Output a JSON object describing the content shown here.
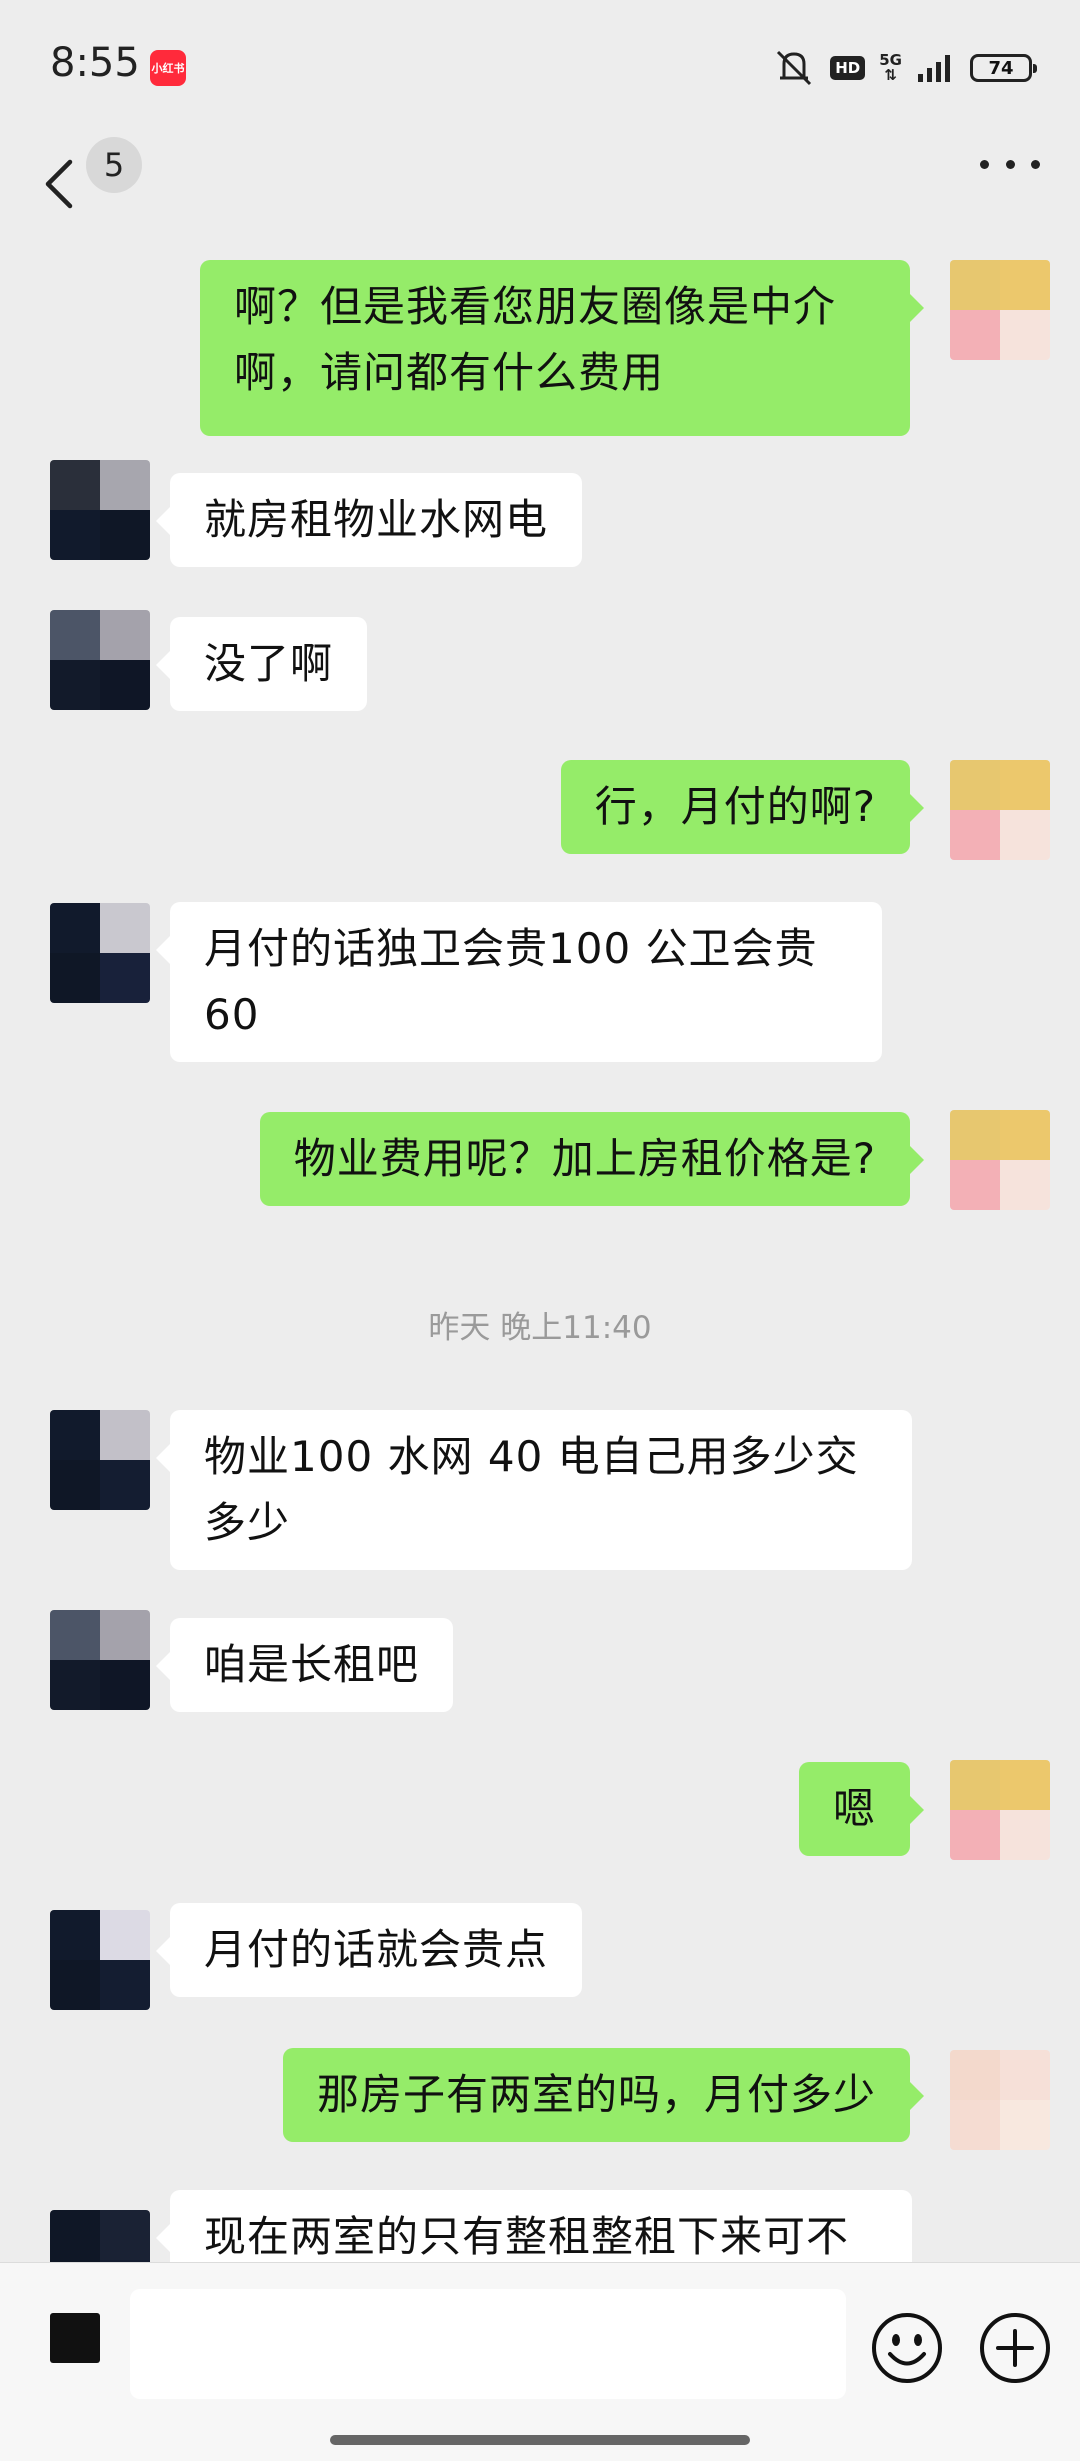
{
  "status_bar": {
    "time": "8:55",
    "app_badge": "小红书",
    "hd": "HD",
    "network": "5G",
    "battery": "74"
  },
  "nav": {
    "unread_count": "5"
  },
  "colors": {
    "outgoing_bubble": "#95ec69",
    "incoming_bubble": "#ffffff",
    "background": "#ededed"
  },
  "messages": [
    {
      "dir": "out",
      "text": "啊？但是我看您朋友圈像是中介啊，请问都有什么费用"
    },
    {
      "dir": "in",
      "text": "就房租物业水网电"
    },
    {
      "dir": "in",
      "text": "没了啊"
    },
    {
      "dir": "out",
      "text": "行，月付的啊?"
    },
    {
      "dir": "in",
      "text": "月付的话独卫会贵100 公卫会贵60"
    },
    {
      "dir": "out",
      "text": "物业费用呢？加上房租价格是?"
    },
    {
      "dir": "in",
      "text": "物业100 水网 40 电自己用多少交多少"
    },
    {
      "dir": "in",
      "text": "咱是长租吧"
    },
    {
      "dir": "out",
      "text": "嗯"
    },
    {
      "dir": "in",
      "text": "月付的话就会贵点"
    },
    {
      "dir": "out",
      "text": "那房子有两室的吗，月付多少"
    },
    {
      "dir": "in",
      "text": "现在两室的只有整租整租下来可不"
    }
  ],
  "timestamp": "昨天 晚上11:40",
  "input": {
    "placeholder": ""
  },
  "icons": [
    "back-arrow-icon",
    "more-dots-icon",
    "voice-icon",
    "emoji-icon",
    "plus-icon",
    "mute-icon",
    "signal-icon",
    "battery-icon"
  ]
}
